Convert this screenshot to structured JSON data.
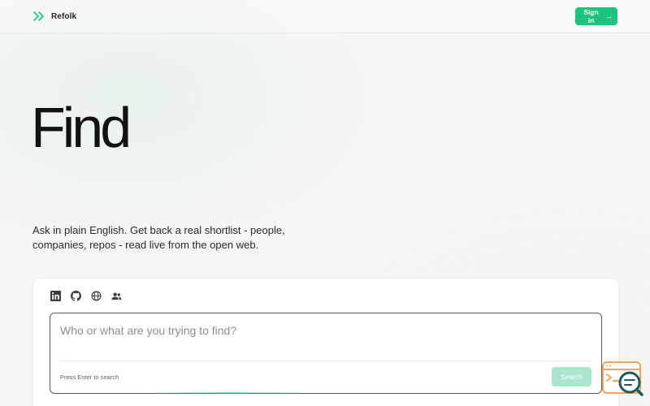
{
  "app": {
    "name": "Refolk"
  },
  "header": {
    "signin_label": "Sign in",
    "signin_arrow": "→"
  },
  "hero": {
    "title": "Find",
    "subtitle": "Ask in plain English. Get back a real shortlist - people, companies, repos - read live from the open web."
  },
  "search": {
    "sources": [
      {
        "icon": "linkedin-icon"
      },
      {
        "icon": "github-icon"
      },
      {
        "icon": "globe-icon"
      },
      {
        "icon": "people-icon"
      }
    ],
    "placeholder": "Who or what are you trying to find?",
    "value": "",
    "hint": "Press Enter to search",
    "button_label": "Search"
  },
  "colors": {
    "accent": "#1ec27e",
    "accent_disabled": "#a9e6cb",
    "widget_orange": "#f2a15e",
    "widget_teal": "#1f5b5c"
  }
}
